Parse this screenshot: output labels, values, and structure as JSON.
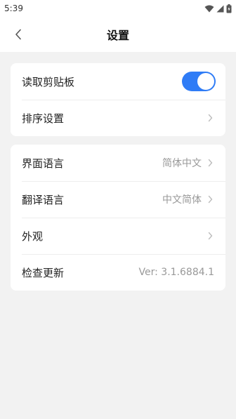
{
  "status_bar": {
    "time": "5:39"
  },
  "header": {
    "title": "设置"
  },
  "card1": {
    "items": [
      {
        "label": "读取剪贴板",
        "toggle_on": true
      },
      {
        "label": "排序设置"
      }
    ]
  },
  "card2": {
    "items": [
      {
        "label": "界面语言",
        "value": "简体中文"
      },
      {
        "label": "翻译语言",
        "value": "中文简体"
      },
      {
        "label": "外观"
      },
      {
        "label": "检查更新",
        "value": "Ver: 3.1.6884.1"
      }
    ]
  },
  "colors": {
    "accent": "#2f7cf6",
    "background": "#f2f2f2"
  }
}
